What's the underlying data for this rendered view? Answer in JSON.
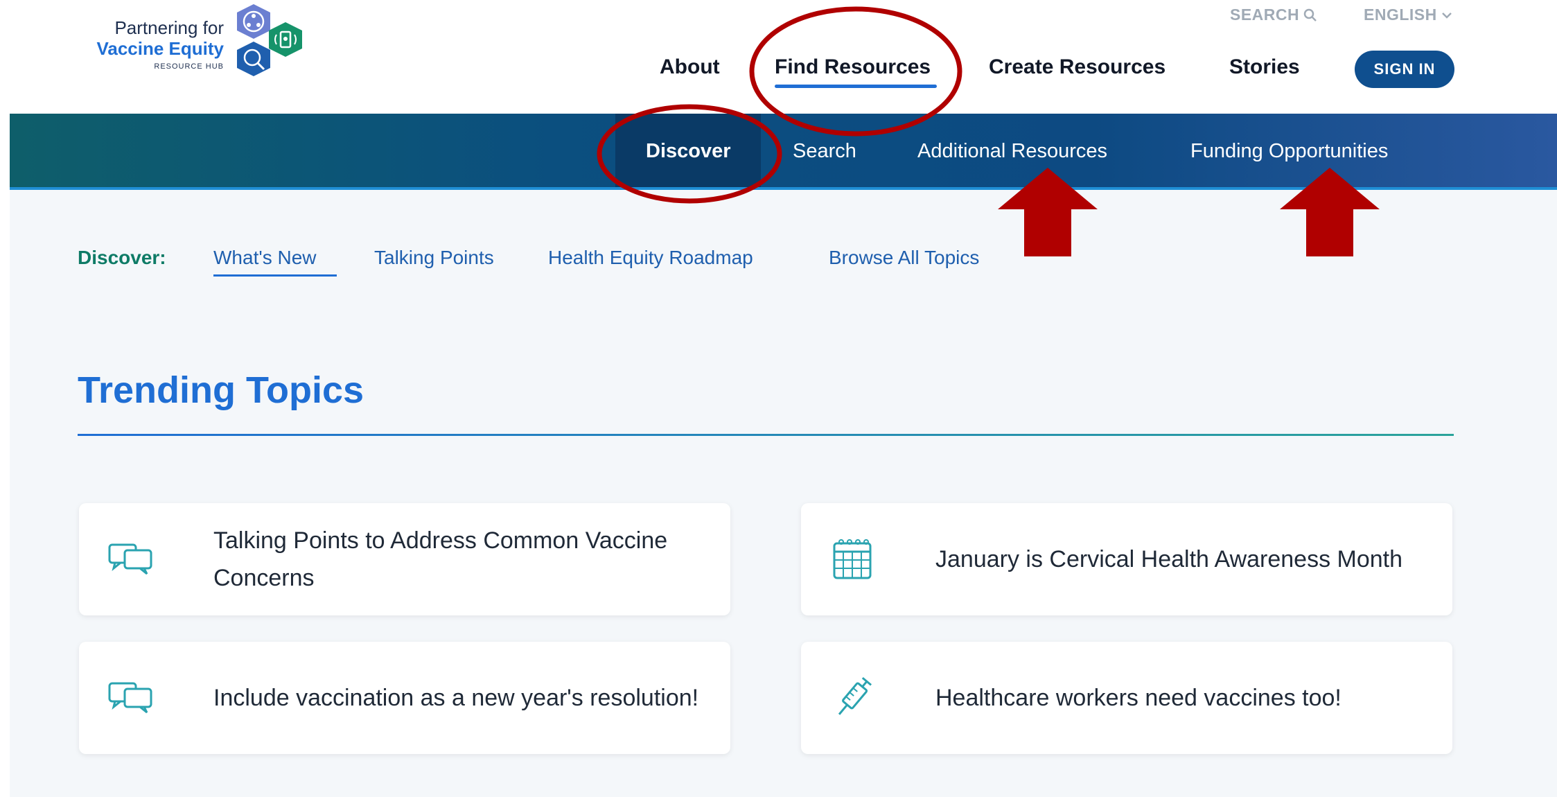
{
  "logo": {
    "line1": "Partnering for",
    "line2": "Vaccine Equity",
    "line3": "RESOURCE HUB",
    "icon": "hexagon-cluster-logo-icon"
  },
  "utility_nav": {
    "search_label": "SEARCH",
    "search_icon": "search-icon",
    "language_label": "ENGLISH",
    "language_icon": "chevron-down-icon"
  },
  "main_nav": {
    "items": [
      "About",
      "Find Resources",
      "Create Resources",
      "Stories"
    ],
    "active": "Find Resources",
    "sign_in_label": "SIGN IN"
  },
  "sub_nav": {
    "items": [
      "Discover",
      "Search",
      "Additional Resources",
      "Funding Opportunities"
    ],
    "active": "Discover"
  },
  "discover_tabs": {
    "label": "Discover:",
    "items": [
      "What's New",
      "Talking Points",
      "Health Equity Roadmap",
      "Browse All Topics"
    ],
    "active": "What's New"
  },
  "trending": {
    "title": "Trending Topics",
    "cards": [
      {
        "text": "Talking Points to Address Common Vaccine Concerns",
        "icon": "speech-bubbles-icon"
      },
      {
        "text": "January is Cervical Health Awareness Month",
        "icon": "calendar-icon"
      },
      {
        "text": "Include vaccination as a new year's resolution!",
        "icon": "speech-bubbles-icon"
      },
      {
        "text": "Healthcare workers need vaccines too!",
        "icon": "syringe-icon"
      }
    ]
  },
  "colors": {
    "brand_blue": "#1f6ed4",
    "dark_navy": "#0f4f8f",
    "teal": "#0e7b66",
    "annotation_red": "#b00000",
    "icon_teal": "#2aa3b0"
  }
}
